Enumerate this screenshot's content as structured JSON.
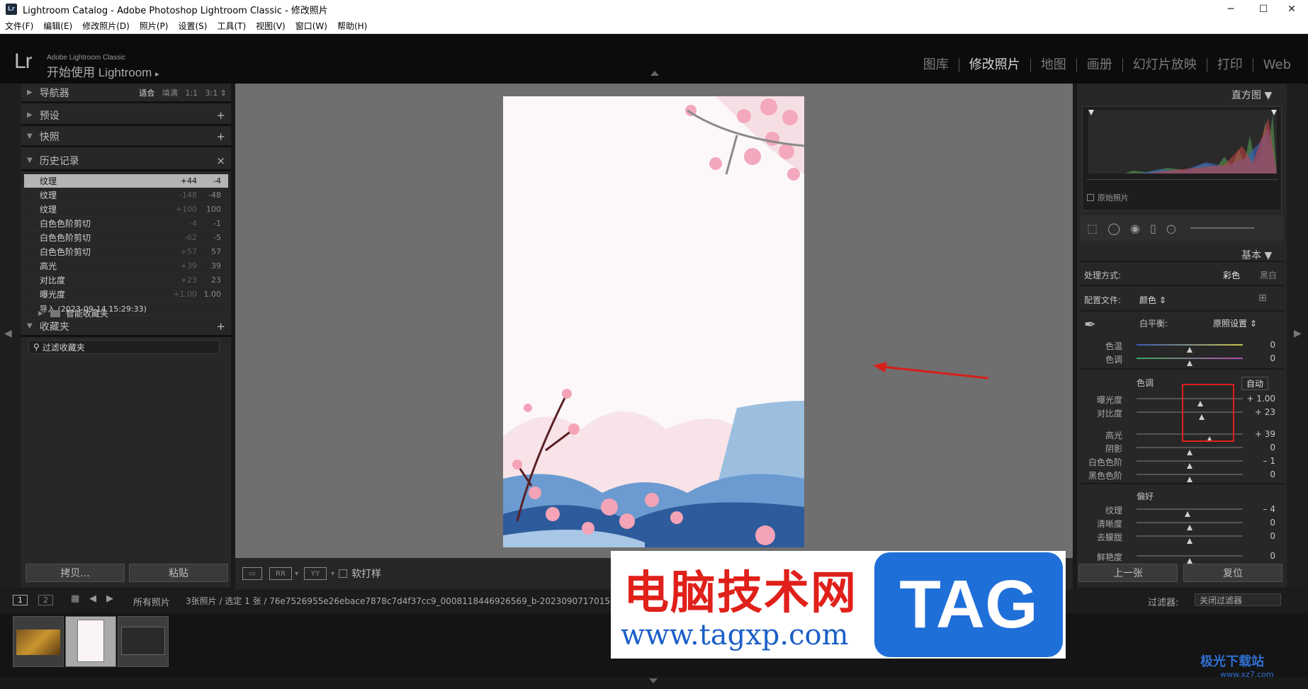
{
  "window": {
    "title": "Lightroom Catalog - Adobe Photoshop Lightroom Classic - 修改照片",
    "icon_text": "Lr",
    "controls": [
      "─",
      "☐",
      "✕"
    ]
  },
  "menu": [
    "文件(F)",
    "编辑(E)",
    "修改照片(D)",
    "照片(P)",
    "设置(S)",
    "工具(T)",
    "视图(V)",
    "窗口(W)",
    "帮助(H)"
  ],
  "identity": {
    "logo": "Lr",
    "small": "Adobe Lightroom Classic",
    "big": "开始使用 Lightroom",
    "arrow": "▸"
  },
  "modules": [
    {
      "label": "图库",
      "active": false
    },
    {
      "label": "修改照片",
      "active": true
    },
    {
      "label": "地图",
      "active": false
    },
    {
      "label": "画册",
      "active": false
    },
    {
      "label": "幻灯片放映",
      "active": false
    },
    {
      "label": "打印",
      "active": false
    },
    {
      "label": "Web",
      "active": false
    }
  ],
  "left": {
    "navigator": {
      "label": "导航器",
      "opts": [
        "适合",
        "填满",
        "1:1",
        "3:1"
      ]
    },
    "presets": {
      "label": "预设",
      "plus": "+"
    },
    "snapshots": {
      "label": "快照",
      "plus": "+"
    },
    "history": {
      "label": "历史记录",
      "close": "×",
      "items": [
        {
          "label": "纹理",
          "a": "+44",
          "b": "-4",
          "selected": true
        },
        {
          "label": "纹理",
          "a": "-148",
          "b": "-48"
        },
        {
          "label": "纹理",
          "a": "+100",
          "b": "100"
        },
        {
          "label": "白色色阶剪切",
          "a": "-4",
          "b": "-1"
        },
        {
          "label": "白色色阶剪切",
          "a": "-62",
          "b": "-5"
        },
        {
          "label": "白色色阶剪切",
          "a": "+57",
          "b": "57"
        },
        {
          "label": "高光",
          "a": "+39",
          "b": "39"
        },
        {
          "label": "对比度",
          "a": "+23",
          "b": "23"
        },
        {
          "label": "曝光度",
          "a": "+1.00",
          "b": "1.00"
        },
        {
          "label": "导入 (2023-09-14 15:29:33)",
          "a": "",
          "b": ""
        }
      ]
    },
    "collections": {
      "label": "收藏夹",
      "plus": "+",
      "filter": "过滤收藏夹",
      "smart": "智能收藏夹"
    },
    "copy_btn": "拷贝...",
    "paste_btn": "粘贴"
  },
  "toolbar": {
    "softproof": "软打样"
  },
  "right": {
    "histogram_label": "直方图",
    "original_photo": "原始照片",
    "basic_label": "基本",
    "treatment": {
      "label": "处理方式:",
      "color": "彩色",
      "bw": "黑白"
    },
    "profile": {
      "label": "配置文件:",
      "value": "颜色"
    },
    "wb": {
      "label": "白平衡:",
      "value": "原照设置"
    },
    "temp": {
      "label": "色温",
      "value": "0",
      "pos": 0.5
    },
    "tint": {
      "label": "色调",
      "value": "0",
      "pos": 0.5
    },
    "tone_label": "色调",
    "auto": "自动",
    "exposure": {
      "label": "曝光度",
      "value": "+ 1.00",
      "pos": 0.6
    },
    "contrast": {
      "label": "对比度",
      "value": "+ 23",
      "pos": 0.61
    },
    "highlights": {
      "label": "高光",
      "value": "+ 39",
      "pos": 0.69
    },
    "shadows": {
      "label": "阴影",
      "value": "0",
      "pos": 0.5
    },
    "whites": {
      "label": "白色色阶",
      "value": "– 1",
      "pos": 0.5
    },
    "blacks": {
      "label": "黑色色阶",
      "value": "0",
      "pos": 0.5
    },
    "presence_label": "偏好",
    "texture": {
      "label": "纹理",
      "value": "– 4",
      "pos": 0.48
    },
    "clarity": {
      "label": "清晰度",
      "value": "0",
      "pos": 0.5
    },
    "dehaze": {
      "label": "去朦胧",
      "value": "0",
      "pos": 0.5
    },
    "vibrance": {
      "label": "鲜艳度",
      "value": "0",
      "pos": 0.5
    },
    "prev_btn": "上一张",
    "reset_btn": "复位"
  },
  "filmstrip": {
    "page1": "1",
    "page2": "2",
    "source": "所有照片",
    "info": "3张照片 / 选定 1 张 / 76e7526955e26ebace7878c7d4f37cc9_0008118446926569_b-20230907170150-x6cpn94.jpg",
    "filter_label": "过滤器:",
    "filter_value": "关闭过滤器"
  },
  "watermark": {
    "title": "电脑技术网",
    "url": "www.tagxp.com",
    "tag": "TAG",
    "corner": "极光下载站",
    "corner_url": "www.xz7.com"
  }
}
